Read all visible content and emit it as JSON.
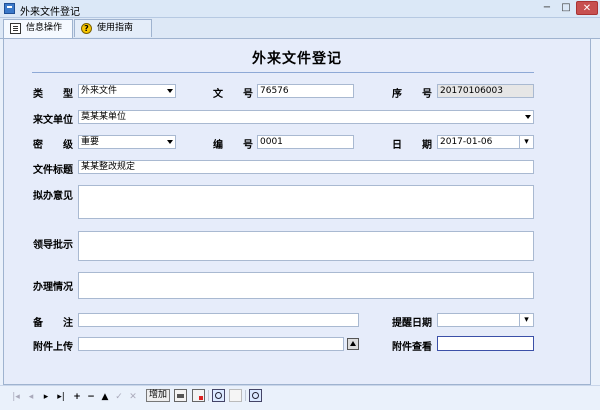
{
  "window": {
    "title": "外来文件登记",
    "min": "−",
    "max": "□",
    "close": "✕"
  },
  "tabs": [
    {
      "label": "信息操作"
    },
    {
      "label": "使用指南"
    }
  ],
  "form": {
    "title": "外来文件登记",
    "labels": {
      "type": "类　　型",
      "doc_no": "文　　号",
      "serial": "序　　号",
      "from_unit": "来文单位",
      "secret": "密　　级",
      "number": "编　　号",
      "date": "日　　期",
      "doc_title": "文件标题",
      "proposal": "拟办意见",
      "leader": "领导批示",
      "status": "办理情况",
      "note": "备　　注",
      "remind_date": "提醒日期",
      "attach_upload": "附件上传",
      "attach_view": "附件查看"
    },
    "values": {
      "type": "外来文件",
      "doc_no": "76576",
      "serial": "20170106003",
      "from_unit": "莫某某单位",
      "secret": "重要",
      "number": "0001",
      "date": "2017-01-06",
      "doc_title": "某某整改规定",
      "note": "",
      "remind_date": "",
      "attach_upload": "",
      "attach_view": ""
    }
  },
  "navbar": {
    "first": "|◂",
    "prev": "◂",
    "next": "▸",
    "last": "▸|",
    "add": "+",
    "delete": "−",
    "up": "▲",
    "check": "✓",
    "cancel": "✕",
    "add_button": "增加"
  },
  "colors": {
    "background": "#eaf1fb",
    "form_bg": "#e6ecfa",
    "close_btn": "#c75050",
    "rule": "#8ea9d6"
  }
}
